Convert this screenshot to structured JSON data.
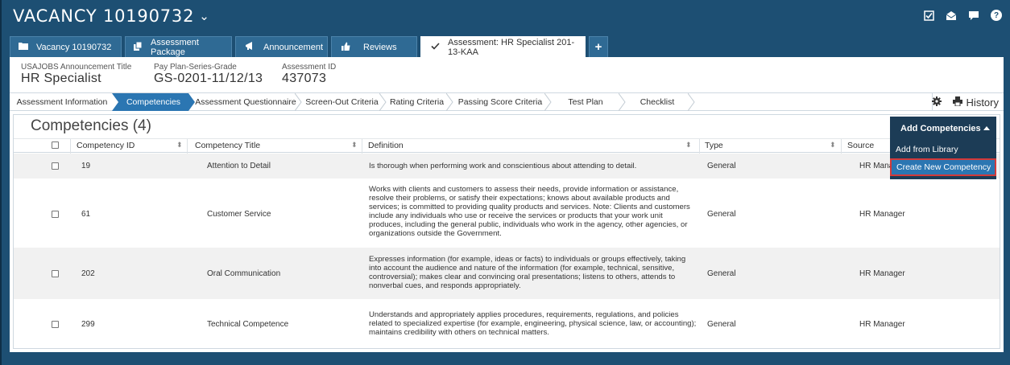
{
  "header": {
    "title": "VACANCY 10190732",
    "icons": [
      "checkbox-icon",
      "mail-open-icon",
      "chat-icon",
      "help-icon"
    ]
  },
  "tabs": [
    {
      "label": "Vacancy 10190732",
      "icon": "folder-icon"
    },
    {
      "label": "Assessment Package",
      "icon": "copy-icon"
    },
    {
      "label": "Announcement",
      "icon": "megaphone-icon"
    },
    {
      "label": "Reviews",
      "icon": "thumbs-up-icon"
    },
    {
      "label": "Assessment: HR Specialist 201-13-KAA",
      "icon": "check-icon",
      "active": true
    }
  ],
  "summary": {
    "announcement_label": "USAJOBS Announcement Title",
    "announcement_value": "HR Specialist",
    "grade_label": "Pay Plan-Series-Grade",
    "grade_value": "GS-0201-11/12/13",
    "assessment_label": "Assessment ID",
    "assessment_value": "437073"
  },
  "steps": [
    "Assessment Information",
    "Competencies",
    "Assessment Questionnaire",
    "Screen-Out Criteria",
    "Rating Criteria",
    "Passing Score Criteria",
    "Test Plan",
    "Checklist"
  ],
  "history_label": "History",
  "section": {
    "title": "Competencies (4)",
    "columns": [
      "Competency ID",
      "Competency Title",
      "Definition",
      "Type",
      "Source"
    ]
  },
  "rows": [
    {
      "id": "19",
      "title": "Attention to Detail",
      "definition": "Is thorough when performing work and conscientious about attending to detail.",
      "type": "General",
      "source": "HR Manag"
    },
    {
      "id": "61",
      "title": "Customer Service",
      "definition": "Works with clients and customers to assess their needs, provide information or assistance, resolve their problems, or satisfy their expectations; knows about available products and services; is committed to providing quality products and services. Note: Clients and customers include any individuals who use or receive the services or products that your work unit produces, including the general public, individuals who work in the agency, other agencies, or organizations outside the Government.",
      "type": "General",
      "source": "HR Manager"
    },
    {
      "id": "202",
      "title": "Oral Communication",
      "definition": "Expresses information (for example, ideas or facts) to individuals or groups effectively, taking into account the audience and nature of the information (for example, technical, sensitive, controversial); makes clear and convincing oral presentations; listens to others, attends to nonverbal cues, and responds appropriately.",
      "type": "General",
      "source": "HR Manager"
    },
    {
      "id": "299",
      "title": "Technical Competence",
      "definition": "Understands and appropriately applies procedures, requirements, regulations, and policies related to specialized expertise (for example, engineering, physical science, law, or accounting); maintains credibility with others on technical matters.",
      "type": "General",
      "source": "HR Manager"
    }
  ],
  "dropdown": {
    "button_label": "Add Competencies",
    "items": [
      "Add from Library",
      "Create New Competency"
    ],
    "highlighted": "Create New Competency"
  },
  "colors": {
    "header_bg": "#1d4f73",
    "tab_bg": "#2f6a94",
    "step_active": "#2b76b2",
    "dropdown_bg": "#1c3c56",
    "highlight_border": "#d23a3a"
  }
}
